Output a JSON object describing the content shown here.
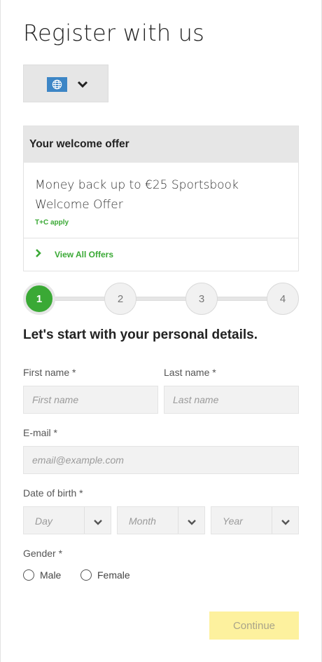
{
  "header": {
    "title": "Register with us"
  },
  "language_selector": {
    "icon": "globe-icon",
    "accent": "#3d86c6"
  },
  "offer": {
    "heading": "Your welcome offer",
    "text": "Money back up to €25 Sportsbook Welcome Offer",
    "terms": "T+C apply",
    "view_all": "View All Offers"
  },
  "stepper": {
    "steps": [
      "1",
      "2",
      "3",
      "4"
    ],
    "active_step": 1,
    "active_color": "#3aa935"
  },
  "form": {
    "section_title": "Let's start with your personal details.",
    "first_name": {
      "label": "First name *",
      "placeholder": "First name",
      "value": ""
    },
    "last_name": {
      "label": "Last name *",
      "placeholder": "Last name",
      "value": ""
    },
    "email": {
      "label": "E-mail *",
      "placeholder": "email@example.com",
      "value": ""
    },
    "dob": {
      "label": "Date of birth *",
      "day": "Day",
      "month": "Month",
      "year": "Year"
    },
    "gender": {
      "label": "Gender *",
      "options": [
        "Male",
        "Female"
      ]
    },
    "continue_label": "Continue",
    "continue_color": "#fdf19e"
  }
}
